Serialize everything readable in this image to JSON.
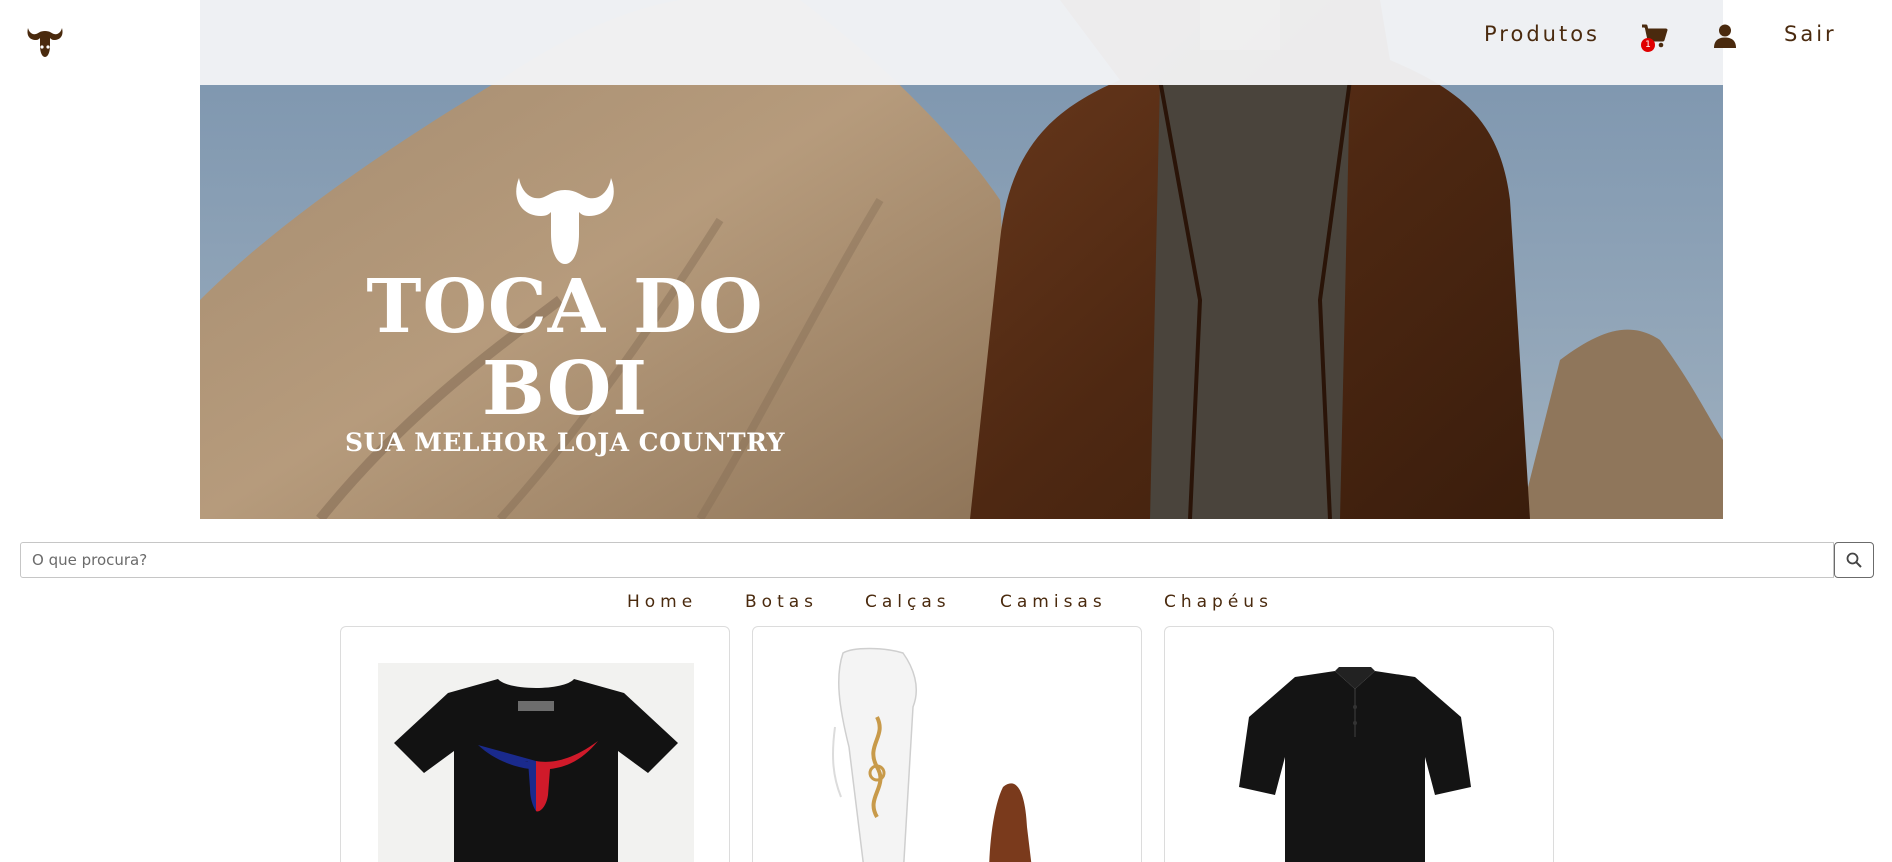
{
  "header": {
    "nav": {
      "produtos": "Produtos",
      "cart_count": "1",
      "sair": "Sair"
    }
  },
  "hero": {
    "brand_title": "TOCA DO BOI",
    "brand_subtitle": "SUA MELHOR LOJA COUNTRY"
  },
  "search": {
    "placeholder": "O que procura?"
  },
  "categories": [
    "Home",
    "Botas",
    "Calças",
    "Camisas",
    "Chapéus"
  ],
  "products": [
    {
      "icon": "tshirt-longhorn-image"
    },
    {
      "icon": "cowboy-boots-image"
    },
    {
      "icon": "polo-shirt-image"
    }
  ],
  "colors": {
    "brand_brown": "#4a2a0e",
    "badge_red": "#e00000"
  }
}
